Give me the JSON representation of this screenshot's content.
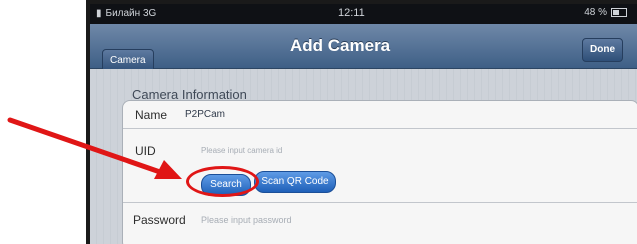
{
  "status_bar": {
    "carrier": "Билайн 3G",
    "time": "12:11",
    "battery": "48 %"
  },
  "nav": {
    "title": "Add Camera",
    "left_button": "Camera",
    "right_button": "Done"
  },
  "form": {
    "section_title": "Camera Information",
    "name_label": "Name",
    "name_value": "P2PCam",
    "uid_label": "UID",
    "uid_placeholder": "Please input camera id",
    "search_button": "Search",
    "scan_button": "Scan QR Code",
    "password_label": "Password",
    "password_placeholder": "Please input password"
  },
  "annotation": {
    "arrow_color": "#e01616",
    "circle_color": "#e01616"
  }
}
